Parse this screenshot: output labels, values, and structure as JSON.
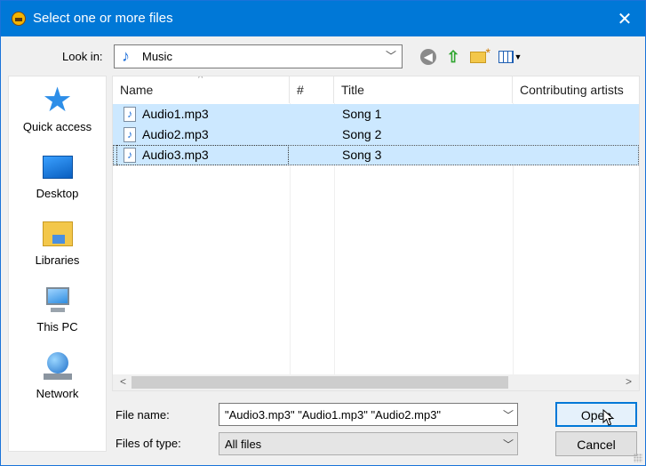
{
  "dialog": {
    "title": "Select one or more files",
    "close_glyph": "✕"
  },
  "toolbar": {
    "look_in_label": "Look in:",
    "look_in_value": "Music",
    "icons": [
      "back-icon",
      "up-one-level-icon",
      "create-new-folder-icon",
      "view-menu-icon"
    ]
  },
  "places": [
    {
      "label": "Quick access",
      "icon": "quick-access-star-icon"
    },
    {
      "label": "Desktop",
      "icon": "desktop-icon"
    },
    {
      "label": "Libraries",
      "icon": "libraries-icon"
    },
    {
      "label": "This PC",
      "icon": "this-pc-icon"
    },
    {
      "label": "Network",
      "icon": "network-icon"
    }
  ],
  "file_list": {
    "columns": [
      "Name",
      "#",
      "Title",
      "Contributing artists"
    ],
    "sort_glyph": "^",
    "rows": [
      {
        "name": "Audio1.mp3",
        "number": "",
        "title": "Song 1",
        "artists": "",
        "selected": true
      },
      {
        "name": "Audio2.mp3",
        "number": "",
        "title": "Song 2",
        "artists": "",
        "selected": true
      },
      {
        "name": "Audio3.mp3",
        "number": "",
        "title": "Song 3",
        "artists": "",
        "selected": true,
        "focused": true
      }
    ],
    "scroll_left_glyph": "<",
    "scroll_right_glyph": ">"
  },
  "bottom": {
    "file_name_label": "File name:",
    "file_name_value": "\"Audio3.mp3\" \"Audio1.mp3\" \"Audio2.mp3\"",
    "files_of_type_label": "Files of type:",
    "files_of_type_value": "All files",
    "open_label": "Open",
    "cancel_label": "Cancel"
  },
  "colors": {
    "titlebar": "#0078d7",
    "selection": "#cce8ff",
    "default_button_border": "#0078d7"
  }
}
